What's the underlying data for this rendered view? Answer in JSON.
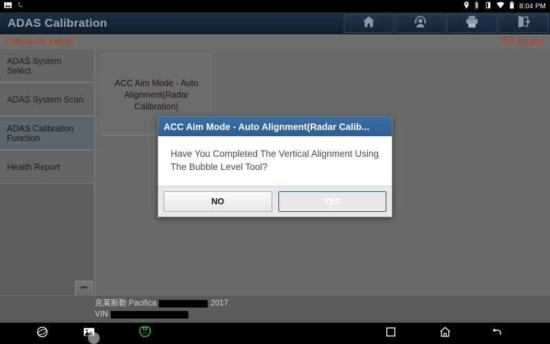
{
  "status_bar": {
    "left_icons": [
      "screenshot-icon",
      "usb-icon"
    ],
    "right_icons": [
      "location-icon",
      "bluetooth-icon",
      "screen-rotation-icon",
      "wifi-icon",
      "battery-icon"
    ],
    "time": "8:04 PM"
  },
  "header": {
    "title": "ADAS Calibration",
    "actions": [
      {
        "name": "home-button",
        "icon": "home-icon"
      },
      {
        "name": "support-button",
        "icon": "headset-person-icon"
      },
      {
        "name": "print-button",
        "icon": "printer-icon"
      },
      {
        "name": "exit-button",
        "icon": "exit-icon"
      }
    ]
  },
  "sub_header": {
    "vehicle_version": "CHRYSLER V33.70",
    "voltage": "12.13V",
    "voltage_icon": "car-battery-icon",
    "accent_color": "#b3422b"
  },
  "sidebar": {
    "items": [
      {
        "label": "ADAS System Select",
        "selected": false
      },
      {
        "label": "ADAS System Scan",
        "selected": false
      },
      {
        "label": "ADAS Calibration Function",
        "selected": true
      },
      {
        "label": "Health Report",
        "selected": false
      }
    ],
    "collapse_button": {
      "glyph": "⏮",
      "name": "collapse-sidebar-button"
    }
  },
  "content": {
    "cards": [
      {
        "label": "ACC Aim Mode - Auto Alignment(Radar Calibration)"
      }
    ]
  },
  "vehicle_info": {
    "make_model_prefix": "克莱斯勒 Pacifica",
    "year": "2017",
    "vin_label": "VIN",
    "model_redacted": true,
    "vin_redacted": true
  },
  "dialog": {
    "title": "ACC Aim Mode - Auto Alignment(Radar Calib...",
    "message": "Have You Completed The Vertical Alignment Using The Bubble Level Tool?",
    "buttons": {
      "no": "NO",
      "yes": "YES"
    },
    "title_bg": "#2f5d92",
    "yes_bg": "#2e5d93"
  },
  "nav_bar": {
    "items": [
      {
        "name": "browser-button",
        "icon": "browser-icon"
      },
      {
        "name": "screenshot-button",
        "icon": "image-icon"
      },
      {
        "name": "vci-button",
        "icon": "vci-connector-icon"
      },
      {
        "name": "recent-apps-button",
        "icon": "square-icon"
      },
      {
        "name": "home-button",
        "icon": "home-icon"
      },
      {
        "name": "back-button",
        "icon": "back-arrow-icon"
      }
    ]
  }
}
